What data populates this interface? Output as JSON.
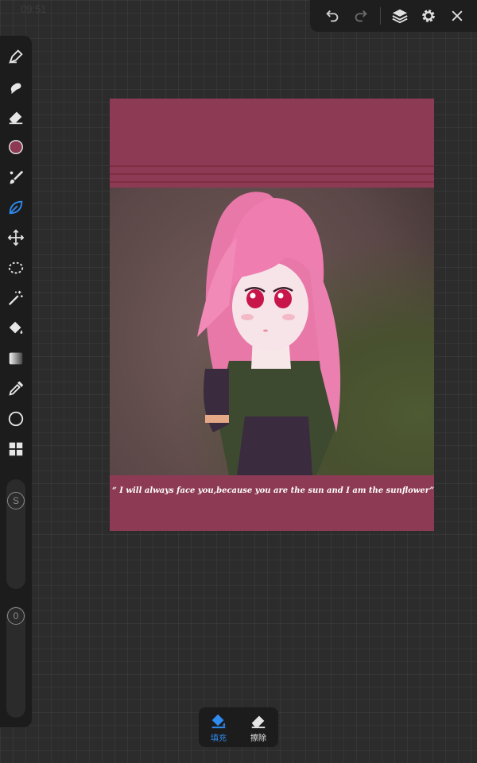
{
  "status_bar": {
    "time": "09:51"
  },
  "top_bar": {
    "undo_icon": "undo-arrow",
    "redo_icon": "redo-arrow",
    "layers_icon": "layers",
    "settings_icon": "gear",
    "close_icon": "x"
  },
  "toolbar": {
    "tools": [
      "pen",
      "smudge",
      "eraser",
      "color",
      "brush",
      "selection-leaf",
      "transform",
      "lasso",
      "magic-wand",
      "paint-bucket",
      "gradient",
      "eyedropper",
      "shape-circle",
      "grid"
    ],
    "current_color": "#8c3a53",
    "accent_color": "#2f8bf0",
    "size_slider_label": "S",
    "opacity_slider_label": "0"
  },
  "artwork": {
    "quote": "“ I will always face you,because you are the sun and I am the sunflower”",
    "frame_color": "#8d3b55"
  },
  "bottom_menu": {
    "fill_label": "填充",
    "erase_label": "擦除"
  }
}
